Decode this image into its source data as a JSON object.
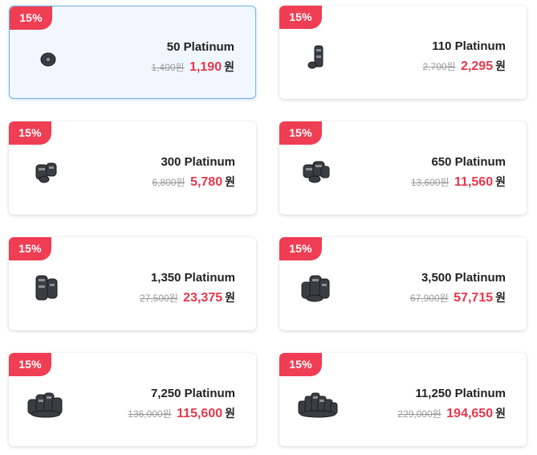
{
  "products": [
    {
      "badge": "15%",
      "amount": "50 Platinum",
      "original": "1,400원",
      "sale": "1,190",
      "currency": "원",
      "icon": "platinum-stack-icon",
      "selected": true
    },
    {
      "badge": "15%",
      "amount": "110 Platinum",
      "original": "2,700원",
      "sale": "2,295",
      "currency": "원",
      "icon": "platinum-stack-icon",
      "selected": false
    },
    {
      "badge": "15%",
      "amount": "300 Platinum",
      "original": "6,800원",
      "sale": "5,780",
      "currency": "원",
      "icon": "platinum-stack-icon",
      "selected": false
    },
    {
      "badge": "15%",
      "amount": "650 Platinum",
      "original": "13,600원",
      "sale": "11,560",
      "currency": "원",
      "icon": "platinum-stack-icon",
      "selected": false
    },
    {
      "badge": "15%",
      "amount": "1,350 Platinum",
      "original": "27,500원",
      "sale": "23,375",
      "currency": "원",
      "icon": "platinum-stack-icon",
      "selected": false
    },
    {
      "badge": "15%",
      "amount": "3,500 Platinum",
      "original": "67,900원",
      "sale": "57,715",
      "currency": "원",
      "icon": "platinum-stack-icon",
      "selected": false
    },
    {
      "badge": "15%",
      "amount": "7,250 Platinum",
      "original": "136,000원",
      "sale": "115,600",
      "currency": "원",
      "icon": "platinum-stack-icon",
      "selected": false
    },
    {
      "badge": "15%",
      "amount": "11,250 Platinum",
      "original": "229,000원",
      "sale": "194,650",
      "currency": "원",
      "icon": "platinum-stack-icon",
      "selected": false
    }
  ],
  "colors": {
    "badge": "#ef3e54",
    "sale_price": "#e8374c",
    "selected_border": "#74b4ea",
    "selected_background": "#f1f7fe"
  }
}
